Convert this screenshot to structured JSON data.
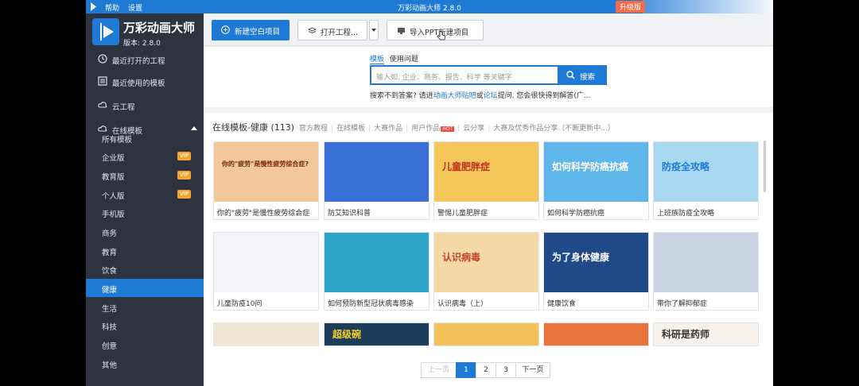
{
  "titlebar": {
    "menu_help": "帮助",
    "menu_settings": "设置",
    "title": "万彩动画大师 2.8.0",
    "upgrade": "升级版"
  },
  "brand": {
    "name": "万彩动画大师",
    "version": "版本: 2.8.0"
  },
  "sidebar": {
    "items": [
      {
        "label": "最近打开的工程",
        "icon": "clock-icon"
      },
      {
        "label": "最近使用的模板",
        "icon": "template-icon"
      },
      {
        "label": "云工程",
        "icon": "cloud-icon"
      },
      {
        "label": "在线模板",
        "icon": "cloud-icon"
      }
    ],
    "sub_items": [
      {
        "label": "所有模板",
        "vip": ""
      },
      {
        "label": "企业版",
        "vip": "VIP"
      },
      {
        "label": "教育版",
        "vip": "VIP"
      },
      {
        "label": "个人版",
        "vip": "VIP"
      },
      {
        "label": "手机版",
        "vip": ""
      },
      {
        "label": "商务",
        "vip": ""
      },
      {
        "label": "教育",
        "vip": ""
      },
      {
        "label": "饮食",
        "vip": ""
      },
      {
        "label": "健康",
        "vip": ""
      },
      {
        "label": "生活",
        "vip": ""
      },
      {
        "label": "科技",
        "vip": ""
      },
      {
        "label": "创意",
        "vip": ""
      },
      {
        "label": "其他",
        "vip": ""
      }
    ],
    "active_sub": "健康"
  },
  "toolbar": {
    "new_project": "新建空白项目",
    "open_project": "打开工程...",
    "import_ppt": "导入PPT新建项目"
  },
  "search": {
    "tab_templates": "模板",
    "tab_help": "使用问题",
    "placeholder": "输入如, 企业、商务、报告、科学 等关键字",
    "button": "搜索",
    "hint_prefix": "搜索不到答案? 请进",
    "hint_link1": "动画大师贴吧",
    "hint_mid": "或",
    "hint_link2": "论坛",
    "hint_suffix": "提问, 您会很快得到解答(广..."
  },
  "content": {
    "title": "在线模板-健康 (113)",
    "filters": [
      "官方教程",
      "在线模板",
      "大赛作品",
      "用户作品",
      "云分享",
      "大赛及优秀作品分享（不断更新中...）"
    ],
    "hot_badge": "HOT",
    "cards": [
      {
        "caption": "你的\"疲劳\"是慢性疲劳综合症",
        "thumb_text": "你的\"疲劳\"是慢性疲劳综合症?",
        "bg": "#f3c89a"
      },
      {
        "caption": "防艾知识科普",
        "thumb_text": "",
        "bg": "#3a6fd8"
      },
      {
        "caption": "警惕儿童肥胖症",
        "thumb_text": "儿童肥胖症",
        "bg": "#f5c65a"
      },
      {
        "caption": "如何科学防癌抗癌",
        "thumb_text": "如何科学防癌抗癌",
        "bg": "#5fb6ea"
      },
      {
        "caption": "上班族防疫全攻略",
        "thumb_text": "防疫全攻略",
        "bg": "#a8d8f0"
      },
      {
        "caption": "儿童防疫10问",
        "thumb_text": "",
        "bg": "#f2f4f8"
      },
      {
        "caption": "如何预防新型冠状病毒感染",
        "thumb_text": "",
        "bg": "#2ea4c8"
      },
      {
        "caption": "认识病毒（上）",
        "thumb_text": "认识病毒",
        "bg": "#f4d9a6"
      },
      {
        "caption": "健康饮食",
        "thumb_text": "为了身体健康",
        "bg": "#1e4a8a"
      },
      {
        "caption": "带你了解抑郁症",
        "thumb_text": "",
        "bg": "#c9d3e3"
      },
      {
        "caption": "",
        "thumb_text": "",
        "bg": "#f0e6d2"
      },
      {
        "caption": "",
        "thumb_text": "超级碗",
        "bg": "#1c3d5a"
      },
      {
        "caption": "",
        "thumb_text": "",
        "bg": "#f5c25a"
      },
      {
        "caption": "",
        "thumb_text": "",
        "bg": "#e8743c"
      },
      {
        "caption": "",
        "thumb_text": "科研是药师",
        "bg": "#f7f2ec"
      }
    ]
  },
  "pager": {
    "prev": "上一页",
    "pages": [
      "1",
      "2",
      "3"
    ],
    "current": "1",
    "next": "下一页"
  }
}
